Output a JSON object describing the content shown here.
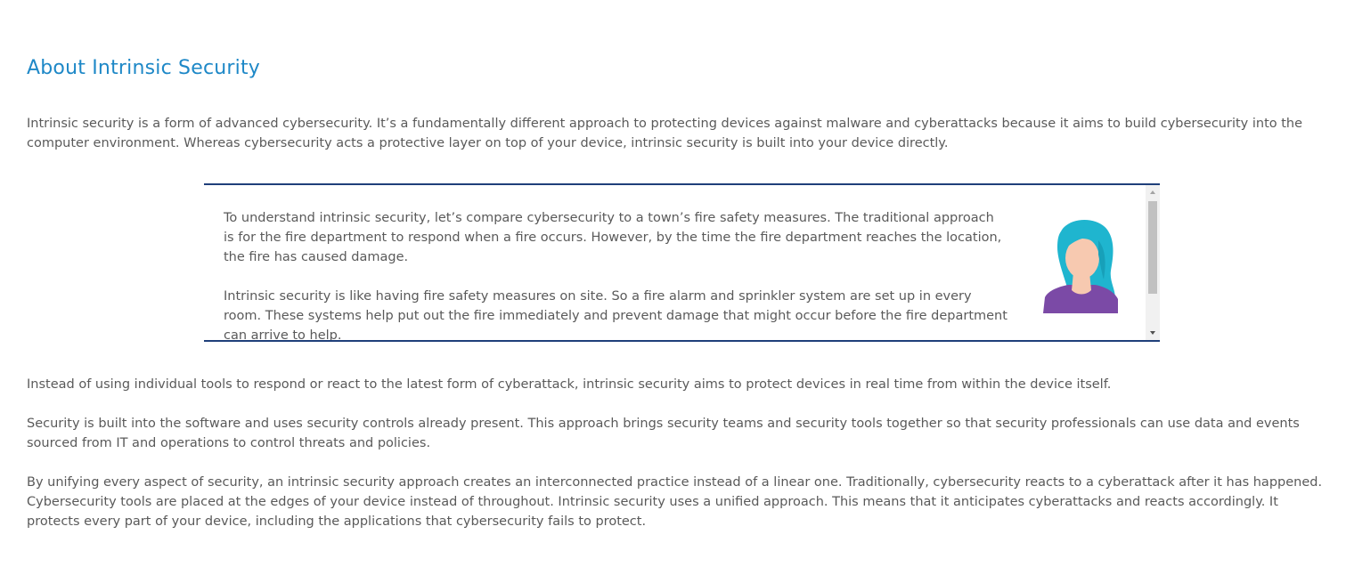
{
  "page": {
    "title": "About Intrinsic Security",
    "intro": "Intrinsic security is a form of advanced cybersecurity. It’s a fundamentally different approach to protecting devices against malware and cyberattacks because it aims to build cybersecurity into the computer environment. Whereas cybersecurity acts a protective layer on top of your device, intrinsic security is built into your device directly."
  },
  "callout": {
    "paragraph_1": "To understand intrinsic security, let’s compare cybersecurity to a town’s fire safety measures. The traditional approach is for the fire department to respond when a fire occurs. However, by the time the fire department reaches the location, the fire has caused damage.",
    "paragraph_2": "Intrinsic security is like having fire safety measures on site. So a fire alarm and sprinkler system are set up in every room. These systems help put out the fire immediately and prevent damage that might occur before the fire department can arrive to help.",
    "avatar_icon": "woman-avatar-icon",
    "colors": {
      "border": "#1f3f7a",
      "hair": "#1fb5cf",
      "skin": "#f7c9b0",
      "shirt": "#7b4aa6"
    }
  },
  "body": {
    "paragraph_1": "Instead of using individual tools to respond or react to the latest form of cyberattack, intrinsic security aims to protect devices in real time from within the device itself.",
    "paragraph_2": "Security is built into the software and uses security controls already present. This approach brings security teams and security tools together so that security professionals can use data and events sourced from IT and operations to control threats and policies.",
    "paragraph_3": "By unifying every aspect of security, an intrinsic security approach creates an interconnected practice instead of a linear one. Traditionally, cybersecurity reacts to a cyberattack after it has happened. Cybersecurity tools are placed at the edges of your device instead of throughout. Intrinsic security uses a unified approach. This means that it anticipates cyberattacks and reacts accordingly. It protects every part of your device, including the applications that cybersecurity fails to protect."
  },
  "theme": {
    "title_color": "#1e88c7",
    "text_color": "#5a5a5a"
  }
}
